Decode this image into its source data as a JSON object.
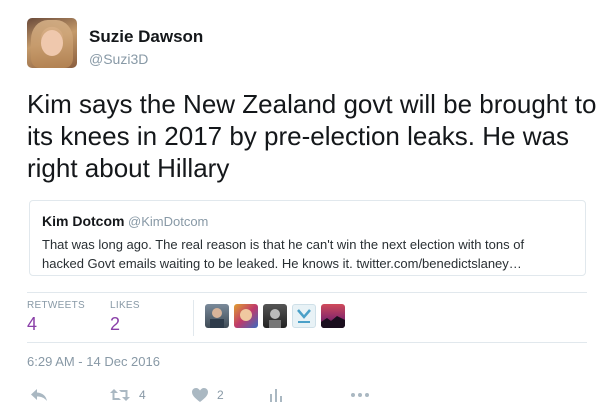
{
  "author": {
    "display_name": "Suzie Dawson",
    "handle": "@Suzi3D"
  },
  "tweet": {
    "text": "Kim says the New Zealand govt will be brought to its knees in 2017 by pre-election leaks. He was right about Hillary"
  },
  "quoted_tweet": {
    "display_name": "Kim Dotcom",
    "handle": "@KimDotcom",
    "line1": "That was long ago. The real reason is that he can't win the next election with tons of",
    "line2": "hacked Govt emails waiting to be leaked. He knows it. twitter.com/benedictslaney…"
  },
  "stats": {
    "retweets_label": "RETWEETS",
    "retweets_value": "4",
    "likes_label": "LIKES",
    "likes_value": "2"
  },
  "likers_icons": [
    "avatar-man-icon",
    "avatar-colorful-icon",
    "avatar-bw-icon",
    "avatar-logo-icon",
    "avatar-sunset-icon"
  ],
  "timestamp": "6:29 AM - 14 Dec 2016",
  "actions": {
    "reply_icon": "reply-icon",
    "retweet_icon": "retweet-icon",
    "retweet_count": "4",
    "like_icon": "heart-icon",
    "like_count": "2",
    "analytics_icon": "analytics-icon",
    "more_icon": "more-icon"
  },
  "colors": {
    "accent_purple": "#8a3fa8",
    "muted": "#8899a6",
    "border": "#e1e8ed"
  }
}
